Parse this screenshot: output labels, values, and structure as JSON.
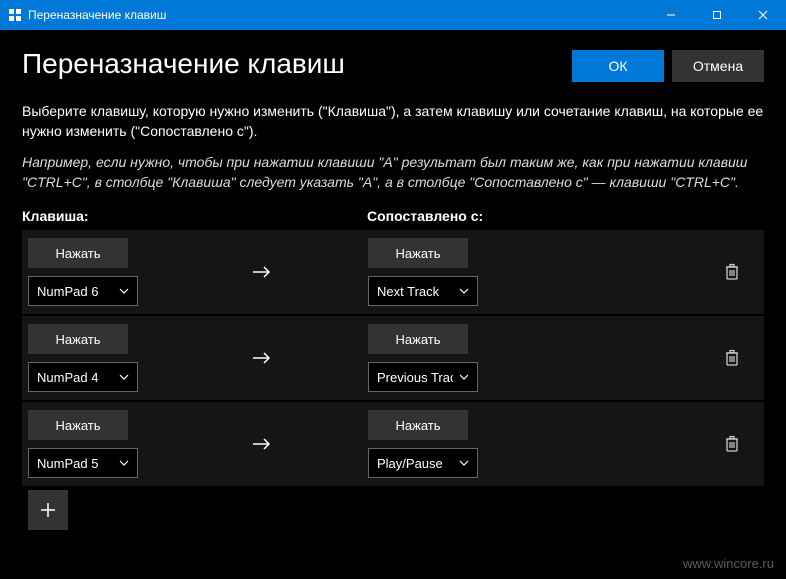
{
  "titlebar": {
    "title": "Переназначение клавиш"
  },
  "header": {
    "title": "Переназначение клавиш",
    "ok_label": "ОК",
    "cancel_label": "Отмена"
  },
  "description": {
    "line1": "Выберите клавишу, которую нужно изменить (\"Клавиша\"), а затем клавишу или сочетание клавиш, на которые ее нужно изменить (\"Сопоставлено с\").",
    "line2": "Например, если нужно, чтобы при нажатии клавиши \"A\" результат был таким же, как при нажатии клавиш \"CTRL+C\", в столбце \"Клавиша\" следует указать \"A\", а в столбце \"Сопоставлено с\" — клавиши \"CTRL+C\"."
  },
  "columns": {
    "key_label": "Клавиша:",
    "mapped_label": "Сопоставлено с:"
  },
  "row_labels": {
    "type_button": "Нажать"
  },
  "rows": [
    {
      "key": "NumPad 6",
      "mapped": "Next Track"
    },
    {
      "key": "NumPad 4",
      "mapped": "Previous Track"
    },
    {
      "key": "NumPad 5",
      "mapped": "Play/Pause"
    }
  ],
  "watermark": "www.wincore.ru",
  "colors": {
    "accent": "#0078d7"
  }
}
